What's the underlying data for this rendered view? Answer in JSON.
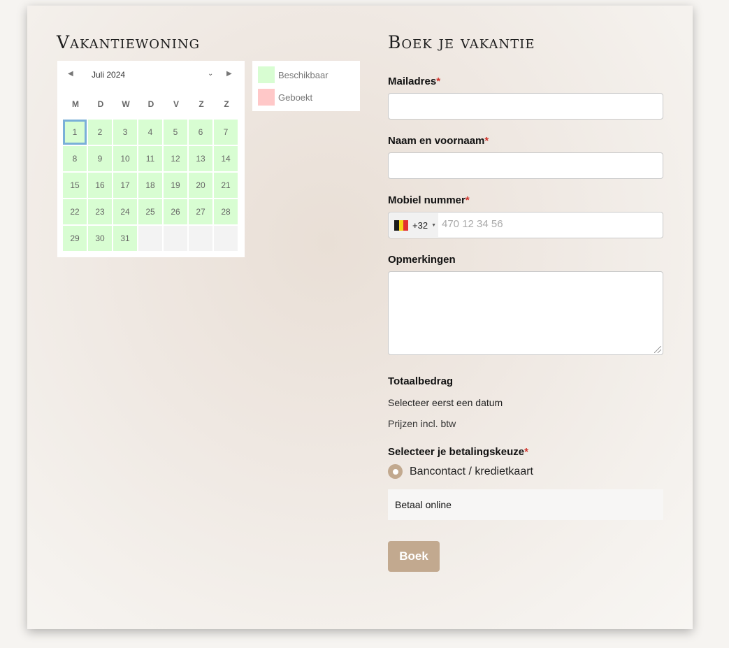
{
  "left": {
    "title": "Vakantiewoning",
    "calendar": {
      "month_label": "Juli 2024",
      "prev_symbol": "◀",
      "next_symbol": "▶",
      "dropdown_symbol": "⌄",
      "weekdays": [
        "M",
        "D",
        "W",
        "D",
        "V",
        "Z",
        "Z"
      ],
      "days": [
        "1",
        "2",
        "3",
        "4",
        "5",
        "6",
        "7",
        "8",
        "9",
        "10",
        "11",
        "12",
        "13",
        "14",
        "15",
        "16",
        "17",
        "18",
        "19",
        "20",
        "21",
        "22",
        "23",
        "24",
        "25",
        "26",
        "27",
        "28",
        "29",
        "30",
        "31"
      ],
      "today": "1",
      "available_color": "#d8fdd2",
      "booked_color": "#ffc8c8",
      "today_border_color": "#7ab0d8"
    },
    "legend": {
      "available_label": "Beschikbaar",
      "booked_label": "Geboekt"
    }
  },
  "form": {
    "title": "Boek je vakantie",
    "email_label": "Mailadres",
    "name_label": "Naam en voornaam",
    "phone_label": "Mobiel nummer",
    "phone_dial_code": "+32",
    "phone_placeholder": "470 12 34 56",
    "phone_flag_icon": "belgium-flag-icon",
    "remarks_label": "Opmerkingen",
    "total_label": "Totaalbedrag",
    "total_text": "Selecteer eerst een datum",
    "vat_note": "Prijzen incl. btw",
    "payment_label": "Selecteer je betalingskeuze",
    "payment_option": "Bancontact / kredietkaart",
    "payment_description": "Betaal online",
    "required_mark": "*",
    "submit_label": "Boek",
    "accent_color": "#c2a98f"
  }
}
